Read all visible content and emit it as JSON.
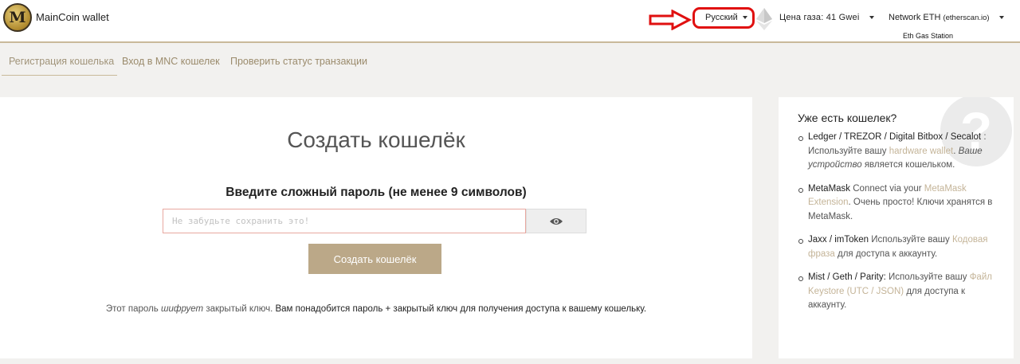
{
  "header": {
    "logo_letter": "M",
    "brand": "MainCoin wallet",
    "language": "Русский",
    "gas_price": "Цена газа: 41 Gwei",
    "network": "Network ETH",
    "network_provider": "(etherscan.io)",
    "gas_station": "Eth Gas Station",
    "colors": {
      "accent": "#c9b99a",
      "highlight": "#e01010"
    }
  },
  "tabs": [
    {
      "label": "Регистрация кошелька"
    },
    {
      "label": "Вход в MNC кошелек"
    },
    {
      "label": "Проверить статус транзакции"
    }
  ],
  "create": {
    "title": "Создать кошелёк",
    "subtitle": "Введите сложный пароль (не менее 9 символов)",
    "placeholder": "Не забудьте сохранить это!",
    "eye_icon": "eye-icon",
    "button": "Создать кошелёк",
    "note": {
      "part1": "Этот пароль",
      "part2": "шифрует",
      "part3": "закрытый ключ.",
      "part4": "Вам понадобится пароль + закрытый ключ для получения доступа к вашему кошельку."
    }
  },
  "sidebar": {
    "title": "Уже есть кошелек?",
    "question_mark": "?",
    "items": [
      {
        "name": "Ledger / TREZOR / Digital Bitbox / Secalot",
        "text1": ": Используйте вашу",
        "link": "hardware wallet",
        "text2": ".",
        "italic": "Ваше устройство",
        "text3": "является кошельком."
      },
      {
        "name": "MetaMask",
        "text1": "Connect via your",
        "link": "MetaMask Extension",
        "text2": ". Очень просто! Ключи хранятся в MetaMask."
      },
      {
        "name": "Jaxx / imToken",
        "text1": "Используйте вашу",
        "link": "Кодовая фраза",
        "text2": "для доступа к аккаунту."
      },
      {
        "name": "Mist / Geth / Parity:",
        "text1": "Используйте вашу",
        "link": "Файл Keystore (UTC / JSON)",
        "text2": "для доступа к аккаунту."
      }
    ]
  }
}
